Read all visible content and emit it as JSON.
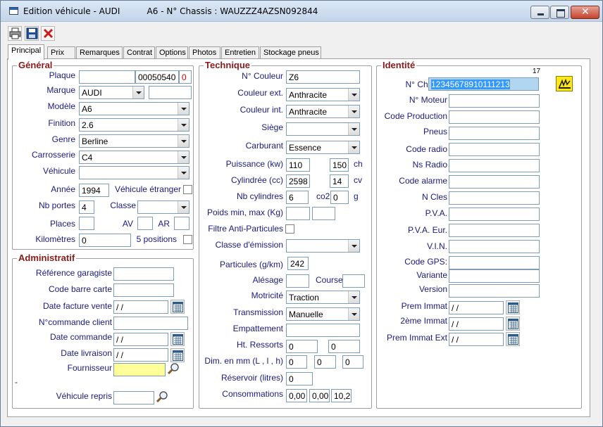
{
  "window": {
    "title": "Edition véhicule - AUDI          A6 - N° Chassis : WAUZZZ4AZSN092844"
  },
  "toolbar": {
    "print_icon": "printer-icon",
    "save_icon": "floppy-disk-icon",
    "close_icon": "red-x-icon"
  },
  "tabs": [
    "Principal",
    "Prix",
    "Remarques",
    "Contrat",
    "Options",
    "Photos",
    "Entretien",
    "Stockage pneus"
  ],
  "general": {
    "title": "Général",
    "plaque_label": "Plaque",
    "plaque_value": "",
    "plaque_num": "00050540",
    "plaque_flag": "0",
    "marque_label": "Marque",
    "marque_value": "AUDI",
    "marque_extra": "",
    "modele_label": "Modèle",
    "modele_value": "A6",
    "finition_label": "Finition",
    "finition_value": "2.6",
    "genre_label": "Genre",
    "genre_value": "Berline",
    "carrosserie_label": "Carrosserie",
    "carrosserie_value": "C4",
    "vehicule_label": "Véhicule",
    "vehicule_value": "",
    "annee_label": "Année",
    "annee_value": "1994",
    "etranger_label": "Véhicule étranger",
    "nb_portes_label": "Nb portes",
    "nb_portes_value": "4",
    "classe_label": "Classe",
    "classe_value": "",
    "places_label": "Places",
    "places_value": "",
    "av_label": "AV",
    "av_value": "",
    "ar_label": "AR",
    "ar_value": "",
    "km_label": "Kilomètres",
    "km_value": "0",
    "positions_label": "5 positions"
  },
  "admin": {
    "title": "Administratif",
    "ref_label": "Référence garagiste",
    "ref_value": "",
    "barre_label": "Code barre carte",
    "barre_value": "",
    "date_facture_label": "Date facture vente",
    "date_facture_value": " / /",
    "commande_client_label": "N°commande client",
    "commande_client_value": "",
    "date_commande_label": "Date commande",
    "date_commande_value": " / /",
    "date_livraison_label": "Date livraison",
    "date_livraison_value": " / /",
    "fournisseur_label": "Fournisseur",
    "fournisseur_value": "",
    "dash": "-",
    "repris_label": "Véhicule repris",
    "repris_value": ""
  },
  "technique": {
    "title": "Technique",
    "couleur_label": "N° Couleur",
    "couleur_value": "Z6",
    "ext_label": "Couleur ext.",
    "ext_value": "Anthracite",
    "int_label": "Couleur int.",
    "int_value": "Anthracite",
    "siege_label": "Siège",
    "siege_value": "",
    "carburant_label": "Carburant",
    "carburant_value": "Essence",
    "puissance_label": "Puissance (kw)",
    "puissance_kw": "110",
    "puissance_ch": "150",
    "ch_unit": "ch",
    "cylindree_label": "Cylindrée (cc)",
    "cylindree_value": "2598",
    "cv_value": "14",
    "cv_unit": "cv",
    "nbcyl_label": "Nb cylindres",
    "nbcyl_value": "6",
    "co2_label": "co2",
    "co2_value": "0",
    "g_unit": "g",
    "poids_label": "Poids min, max (Kg)",
    "poids_min": "",
    "poids_max": "",
    "filtre_label": "Filtre Anti-Particules",
    "emission_label": "Classe d'émission",
    "emission_value": "",
    "particules_label": "Particules (g/km)",
    "particules_value": "242",
    "alesage_label": "Alésage",
    "alesage_value": "",
    "course_label": "Course",
    "course_value": "",
    "motricite_label": "Motricité",
    "motricite_value": "Traction",
    "transmission_label": "Transmission",
    "transmission_value": "Manuelle",
    "empattement_label": "Empattement",
    "empattement_value": "",
    "ressorts_label": "Ht. Ressorts",
    "ressorts_1": "0",
    "ressorts_2": "0",
    "dim_label": "Dim. en mm (L , l , h)",
    "dim_l": "0",
    "dim_w": "0",
    "dim_h": "0",
    "reservoir_label": "Réservoir (litres)",
    "reservoir_value": "0",
    "conso_label": "Consommations",
    "conso_1": "0,00",
    "conso_2": "0,00",
    "conso_3": "10,20"
  },
  "identite": {
    "title": "Identité",
    "counter": "17",
    "chassis_label": "N° Chassis",
    "chassis_value": "12345678910111213",
    "moteur_label": "N° Moteur",
    "moteur_value": "",
    "code_prod_label": "Code Production",
    "code_prod_value": "",
    "pneus_label": "Pneus",
    "pneus_value": "",
    "radio_label": "Code radio",
    "radio_value": "",
    "ns_radio_label": "Ns Radio",
    "ns_radio_value": "",
    "alarme_label": "Code alarme",
    "alarme_value": "",
    "cles_label": "N Cles",
    "cles_value": "",
    "pva_label": "P.V.A.",
    "pva_value": "",
    "pva_eur_label": "P.V.A. Eur.",
    "pva_eur_value": "",
    "vin_label": "V.I.N.",
    "vin_value": "",
    "gps_label": "Code GPS:",
    "gps_value": "",
    "variante_label": "Variante",
    "variante_value": "",
    "version_label": "Version",
    "version_value": "",
    "prem_immat_label": "Prem Immat",
    "prem_immat_value": " / /",
    "deux_immat_label": "2ème Immat",
    "deux_immat_value": " / /",
    "prem_ext_label": "Prem Immat Ext",
    "prem_ext_value": " / /"
  }
}
